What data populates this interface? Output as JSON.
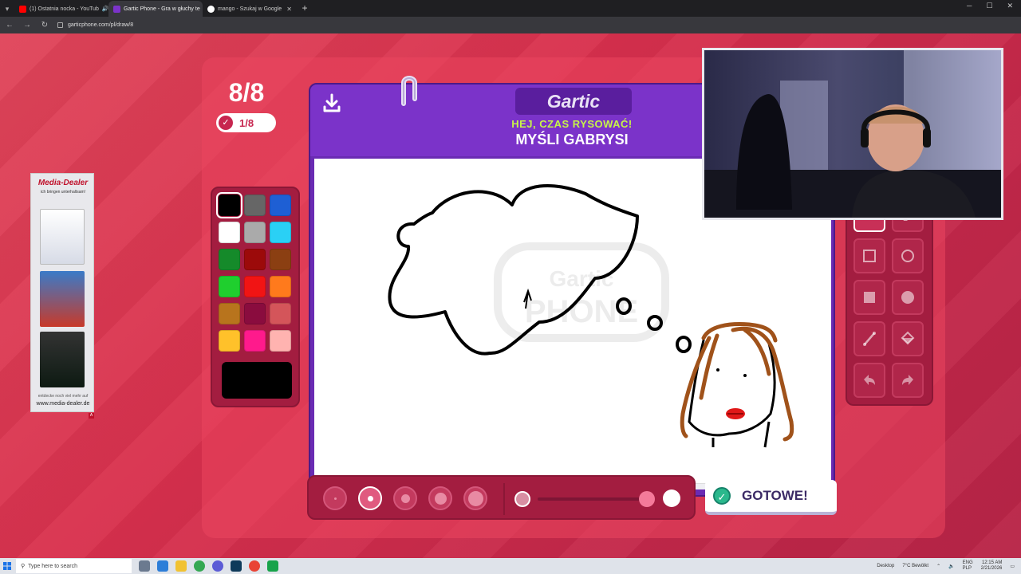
{
  "browser": {
    "tabs": [
      {
        "label": "(1) Ostatnia nocka - YouTub",
        "active": false,
        "muted_icon": "speaker-icon"
      },
      {
        "label": "Gartic Phone - Gra w głuchy te",
        "active": true
      },
      {
        "label": "mango - Szukaj w Google",
        "active": false
      }
    ],
    "url": "garticphone.com/pl/draw/8"
  },
  "game": {
    "round": "8/8",
    "done_count": "1/8",
    "logo": "Gartic",
    "subtitle": "HEJ, CZAS RYSOWAĆ!",
    "title": "MYŚLI GABRYSI",
    "done_button": "GOTOWE!",
    "palette": [
      "#000000",
      "#666666",
      "#1e5fd4",
      "#ffffff",
      "#aaaaaa",
      "#2ad0f5",
      "#158a2a",
      "#9c0a0a",
      "#8b3f12",
      "#1fcf2e",
      "#f11414",
      "#ff7a1c",
      "#b8741d",
      "#8a0c3e",
      "#d4555a",
      "#ffc12a",
      "#ff1a8c",
      "#ffb3b0"
    ],
    "selected_color": "#000000",
    "tools": [
      "pencil-icon",
      "eraser-icon",
      "square-outline-icon",
      "circle-outline-icon",
      "square-fill-icon",
      "circle-fill-icon",
      "line-icon",
      "fill-bucket-icon",
      "undo-icon",
      "redo-icon"
    ],
    "selected_tool": "pencil-icon",
    "brush_sizes": 5,
    "selected_size": 2,
    "opacity_level": 0.95
  },
  "ad": {
    "brand": "Media-Dealer",
    "tagline": "ich bringen unterhaltsam!",
    "footer": "entdecke noch viel mehr auf",
    "site": "www.media-dealer.de",
    "badge": "A"
  },
  "taskbar": {
    "search_placeholder": "Type here to search",
    "desktop": "Desktop",
    "weather": "7°C  Bewölkt",
    "lang": "ENG",
    "region": "PLP",
    "time": "12:15 AM",
    "date": "2/21/2026"
  }
}
